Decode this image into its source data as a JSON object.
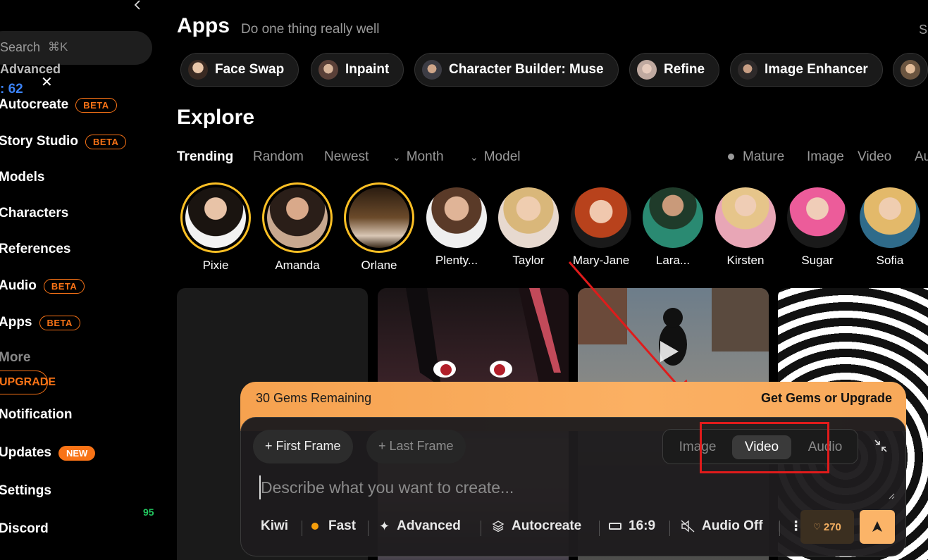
{
  "sidebar": {
    "search_label": "Search",
    "search_shortcut": "⌘K",
    "advanced_partial": "Advanced",
    "count_label": ": 62",
    "items": [
      {
        "label": "Autocreate",
        "badge": "BETA"
      },
      {
        "label": "Story Studio",
        "badge": "BETA"
      },
      {
        "label": "Models"
      },
      {
        "label": "Characters"
      },
      {
        "label": "References"
      },
      {
        "label": "Audio",
        "badge": "BETA"
      },
      {
        "label": "Apps",
        "badge": "BETA"
      },
      {
        "label": "More"
      }
    ],
    "upgrade_label": "UPGRADE",
    "bottom_items": [
      {
        "label": "Notification"
      },
      {
        "label": "Updates",
        "badge": "NEW"
      },
      {
        "label": "Settings"
      },
      {
        "label": "Discord"
      }
    ],
    "green_count": "95"
  },
  "apps": {
    "title": "Apps",
    "subtitle": "Do one thing really well",
    "right_partial": "S",
    "chips": [
      {
        "label": "Face Swap"
      },
      {
        "label": "Inpaint"
      },
      {
        "label": "Character Builder: Muse"
      },
      {
        "label": "Refine"
      },
      {
        "label": "Image Enhancer"
      },
      {
        "label": ""
      }
    ]
  },
  "explore": {
    "title": "Explore",
    "tabs": [
      "Trending",
      "Random",
      "Newest",
      "Month",
      "Model"
    ],
    "right_tabs": [
      "Mature",
      "Image",
      "Video",
      "Au"
    ],
    "characters": [
      {
        "name": "Pixie",
        "featured": true
      },
      {
        "name": "Amanda",
        "featured": true
      },
      {
        "name": "Orlane",
        "featured": true
      },
      {
        "name": "Plenty...",
        "featured": false
      },
      {
        "name": "Taylor",
        "featured": false
      },
      {
        "name": "Mary-Jane",
        "featured": false
      },
      {
        "name": "Lara...",
        "featured": false
      },
      {
        "name": "Kirsten",
        "featured": false
      },
      {
        "name": "Sugar",
        "featured": false
      },
      {
        "name": "Sofia",
        "featured": false
      }
    ]
  },
  "composer": {
    "gems_remaining": "30 Gems Remaining",
    "get_gems": "Get Gems or Upgrade",
    "first_frame": "+ First Frame",
    "last_frame": "+ Last Frame",
    "modes": [
      "Image",
      "Video",
      "Audio"
    ],
    "active_mode": "Video",
    "placeholder": "Describe what you want to create...",
    "model": "Kiwi",
    "speed": "Fast",
    "advanced": "Advanced",
    "autocreate": "Autocreate",
    "aspect": "16:9",
    "audio": "Audio Off",
    "gem_cost": "270"
  },
  "colors": {
    "accent": "#f97316",
    "gems_bar": "#fbb063",
    "highlight": "#e01b1b"
  }
}
